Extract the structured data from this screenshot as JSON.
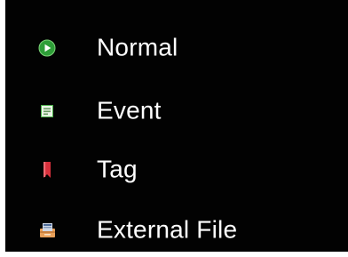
{
  "menu": {
    "items": [
      {
        "label": "Normal",
        "icon": "play-circle-icon",
        "color": "#2e9e38"
      },
      {
        "label": "Event",
        "icon": "event-note-icon",
        "color": "#4bb04a"
      },
      {
        "label": "Tag",
        "icon": "bookmark-tag-icon",
        "color": "#d8303c"
      },
      {
        "label": "External File",
        "icon": "external-file-icon",
        "color": "#e8a05a"
      }
    ]
  }
}
